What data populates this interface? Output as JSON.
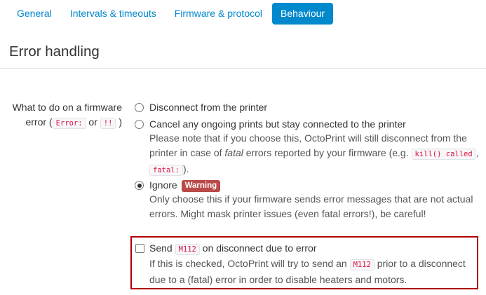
{
  "tabs": [
    {
      "label": "General",
      "active": false
    },
    {
      "label": "Intervals & timeouts",
      "active": false
    },
    {
      "label": "Firmware & protocol",
      "active": false
    },
    {
      "label": "Behaviour",
      "active": true
    }
  ],
  "section": {
    "title": "Error handling"
  },
  "firmware_error": {
    "label_prefix": "What to do on a firmware error (",
    "label_code1": "Error:",
    "label_or": " or ",
    "label_code2": "!!",
    "label_suffix": " )",
    "options": [
      {
        "label": "Disconnect from the printer",
        "checked": false
      },
      {
        "label": "Cancel any ongoing prints but stay connected to the printer",
        "checked": false,
        "help_part1": "Please note that if you choose this, OctoPrint will still disconnect from the printer in case of ",
        "help_em": "fatal",
        "help_part2": " errors reported by your firmware (e.g. ",
        "help_code1": "kill() called",
        "help_sep": ", ",
        "help_code2": "fatal:",
        "help_end": ")."
      },
      {
        "label": "Ignore",
        "badge": "Warning",
        "checked": true,
        "help": "Only choose this if your firmware sends error messages that are not actual errors. Might mask printer issues (even fatal errors!), be careful!"
      }
    ]
  },
  "send_m112": {
    "checked": false,
    "label_prefix": "Send ",
    "label_code": "M112",
    "label_suffix": " on disconnect due to error",
    "help_prefix": "If this is checked, OctoPrint will try to send an ",
    "help_code": "M112",
    "help_suffix": " prior to a disconnect due to a (fatal) error in order to disable heaters and motors."
  },
  "colors": {
    "accent": "#0088cc",
    "warning": "#b94a48",
    "highlight_border": "#b00000",
    "code_text": "#dd1144"
  }
}
